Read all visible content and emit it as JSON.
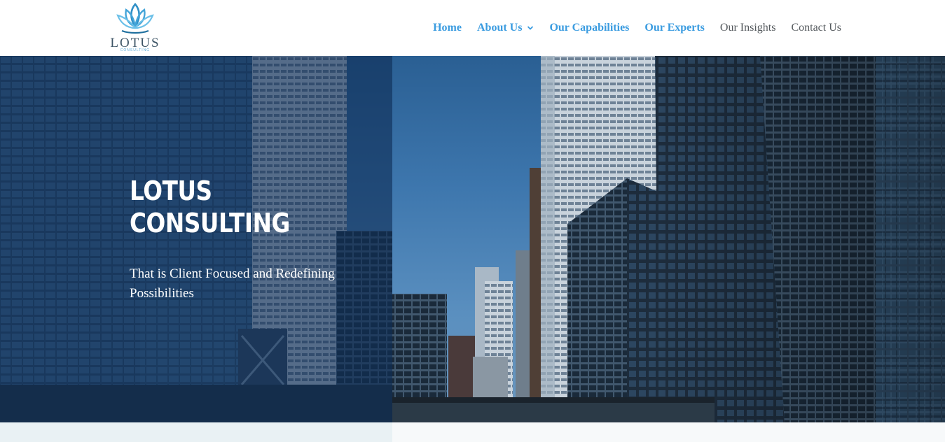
{
  "brand": {
    "name": "LOTUS",
    "tagline": "CONSULTING"
  },
  "nav": {
    "items": [
      {
        "label": "Home"
      },
      {
        "label": "About Us"
      },
      {
        "label": "Our Capabilities"
      },
      {
        "label": "Our Experts"
      },
      {
        "label": "Our Insights"
      },
      {
        "label": "Contact Us"
      }
    ]
  },
  "hero": {
    "title_line1": "LOTUS",
    "title_line2": "CONSULTING",
    "subtitle": "That is Client Focused and Redefining Possibilities"
  },
  "colors": {
    "accent": "#3b9ce0",
    "nav_inactive": "#555a5e",
    "overlay": "#0f2d55",
    "strip_left": "#e9f1f4"
  },
  "icons": {
    "logo": "lotus-flower-icon",
    "dropdown": "chevron-down-icon"
  }
}
